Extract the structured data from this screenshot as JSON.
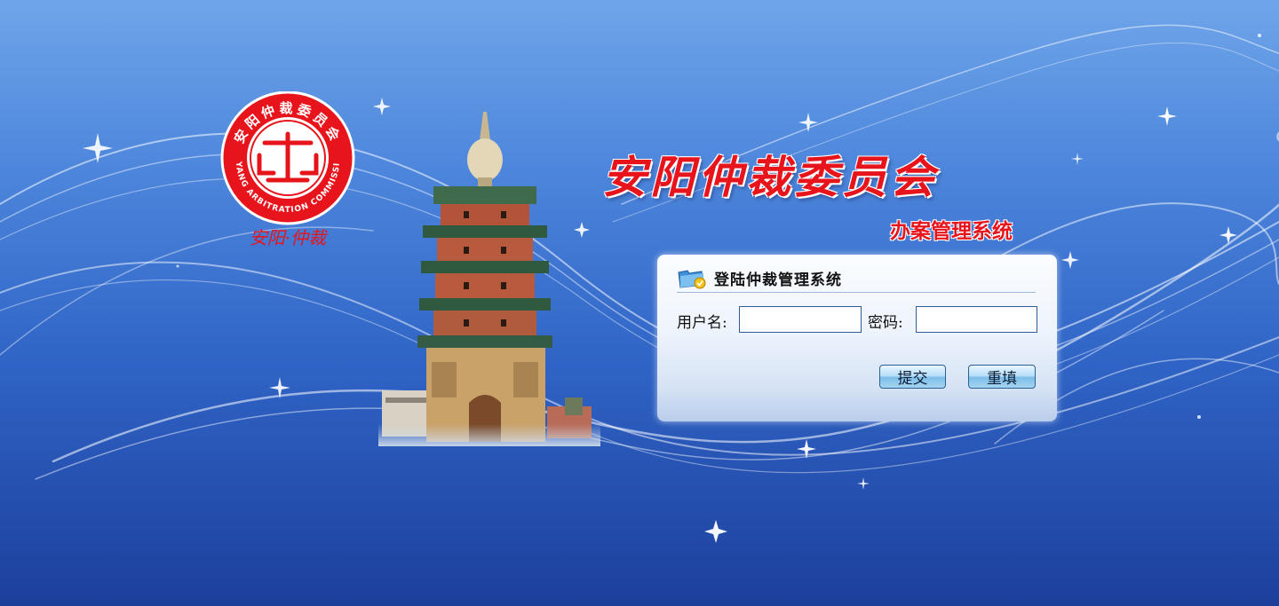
{
  "header": {
    "title": "安阳仲裁委员会",
    "subtitle": "办案管理系统"
  },
  "logo": {
    "ring_text_cn": "安阳仲裁委员会",
    "ring_text_en": "ANYANG ARBITRATION COMMISSION",
    "caption": "安阳·仲裁",
    "brand_color": "#e8141c"
  },
  "login_panel": {
    "title": "登陆仲裁管理系统",
    "icon": "login-folder-icon",
    "username_label": "用户名:",
    "username_value": "",
    "password_label": "密码:",
    "password_value": "",
    "submit_label": "提交",
    "reset_label": "重填"
  },
  "colors": {
    "background_top": "#6fa5e9",
    "background_bottom": "#1d3f9c",
    "title_red": "#e8141c",
    "input_border": "#2e5d99"
  }
}
